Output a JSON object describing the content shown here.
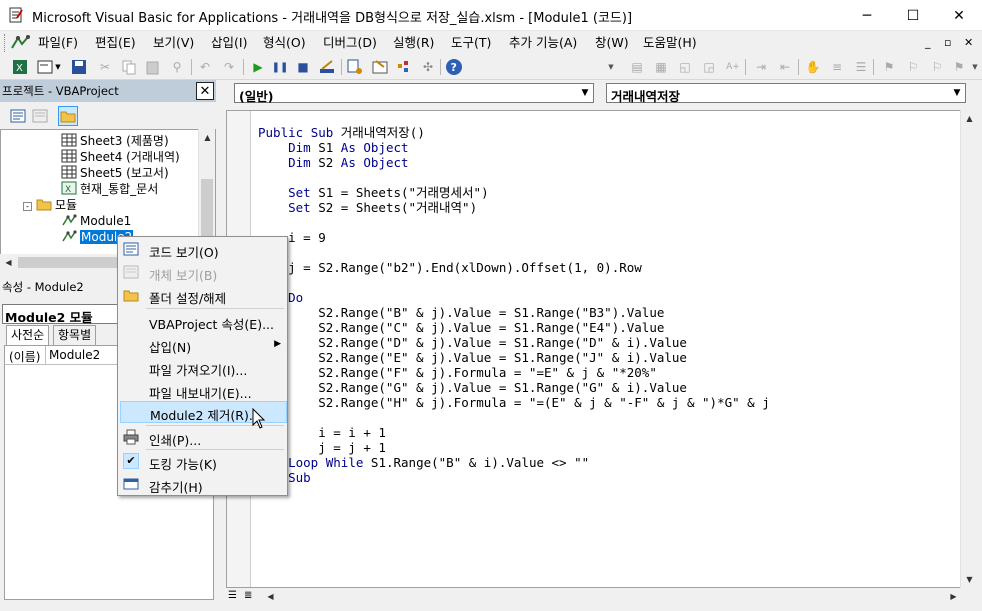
{
  "window": {
    "title": "Microsoft Visual Basic for Applications - 거래내역을 DB형식으로 저장_실습.xlsm - [Module1 (코드)]",
    "minimize": "─",
    "maximize": "☐",
    "close": "✕"
  },
  "menu": {
    "items": [
      "파일(F)",
      "편집(E)",
      "보기(V)",
      "삽입(I)",
      "형식(O)",
      "디버그(D)",
      "실행(R)",
      "도구(T)",
      "추가 기능(A)",
      "창(W)",
      "도움말(H)"
    ],
    "mdi_min": "_",
    "mdi_restore": "▫",
    "mdi_close": "✕"
  },
  "project": {
    "title": "프로젝트 - VBAProject",
    "close": "✕",
    "tree": [
      {
        "label": "Sheet3 (제품명)",
        "icon": "sheet-icon"
      },
      {
        "label": "Sheet4 (거래내역)",
        "icon": "sheet-icon"
      },
      {
        "label": "Sheet5 (보고서)",
        "icon": "sheet-icon"
      },
      {
        "label": "현재_통합_문서",
        "icon": "workbook-icon"
      },
      {
        "label": "모듈",
        "icon": "folder-icon"
      },
      {
        "label": "Module1",
        "icon": "module-icon"
      },
      {
        "label": "Module2",
        "icon": "module-icon"
      }
    ]
  },
  "properties": {
    "title": "속성 - Module2",
    "object_label": "Module2 모듈",
    "tab_alpha": "사전순",
    "tab_category": "항목별",
    "row_name": "(이름)",
    "row_value": "Module2"
  },
  "code": {
    "object_combo": "(일반)",
    "proc_combo": "거래내역저장",
    "lines": [
      "Public Sub 거래내역저장()",
      "    Dim S1 As Object",
      "    Dim S2 As Object",
      "",
      "    Set S1 = Sheets(\"거래명세서\")",
      "    Set S2 = Sheets(\"거래내역\")",
      "",
      "    i = 9",
      "",
      "    j = S2.Range(\"b2\").End(xlDown).Offset(1, 0).Row",
      "",
      "    Do",
      "        S2.Range(\"B\" & j).Value = S1.Range(\"B3\").Value",
      "        S2.Range(\"C\" & j).Value = S1.Range(\"E4\").Value",
      "        S2.Range(\"D\" & j).Value = S1.Range(\"D\" & i).Value",
      "        S2.Range(\"E\" & j).Value = S1.Range(\"J\" & i).Value",
      "        S2.Range(\"F\" & j).Formula = \"=E\" & j & \"*20%\"",
      "        S2.Range(\"G\" & j).Value = S1.Range(\"G\" & i).Value",
      "        S2.Range(\"H\" & j).Formula = \"=(E\" & j & \"-F\" & j & \")*G\" & j",
      "",
      "        i = i + 1",
      "        j = j + 1",
      "    Loop While S1.Range(\"B\" & i).Value <> \"\"",
      "    Sub"
    ]
  },
  "context_menu": {
    "items": [
      {
        "label": "코드 보기(O)",
        "icon": "code-view-icon",
        "enabled": true
      },
      {
        "label": "개체 보기(B)",
        "icon": "object-view-icon",
        "enabled": false
      },
      {
        "label": "폴더 설정/해제",
        "icon": "folder-icon",
        "enabled": true
      },
      {
        "label": "VBAProject 속성(E)...",
        "icon": "",
        "enabled": true
      },
      {
        "label": "삽입(N)",
        "icon": "",
        "enabled": true,
        "submenu": true
      },
      {
        "label": "파일 가져오기(I)...",
        "icon": "",
        "enabled": true
      },
      {
        "label": "파일 내보내기(E)...",
        "icon": "",
        "enabled": true
      },
      {
        "label": "Module2 제거(R)...",
        "icon": "",
        "enabled": true,
        "highlighted": true
      },
      {
        "label": "인쇄(P)...",
        "icon": "print-icon",
        "enabled": true
      },
      {
        "label": "도킹 가능(K)",
        "icon": "check-icon",
        "enabled": true
      },
      {
        "label": "감추기(H)",
        "icon": "hide-icon",
        "enabled": true
      }
    ]
  },
  "colors": {
    "keyword": "#00008b",
    "highlight": "#cce8ff",
    "pane_header": "#bfcddb"
  }
}
